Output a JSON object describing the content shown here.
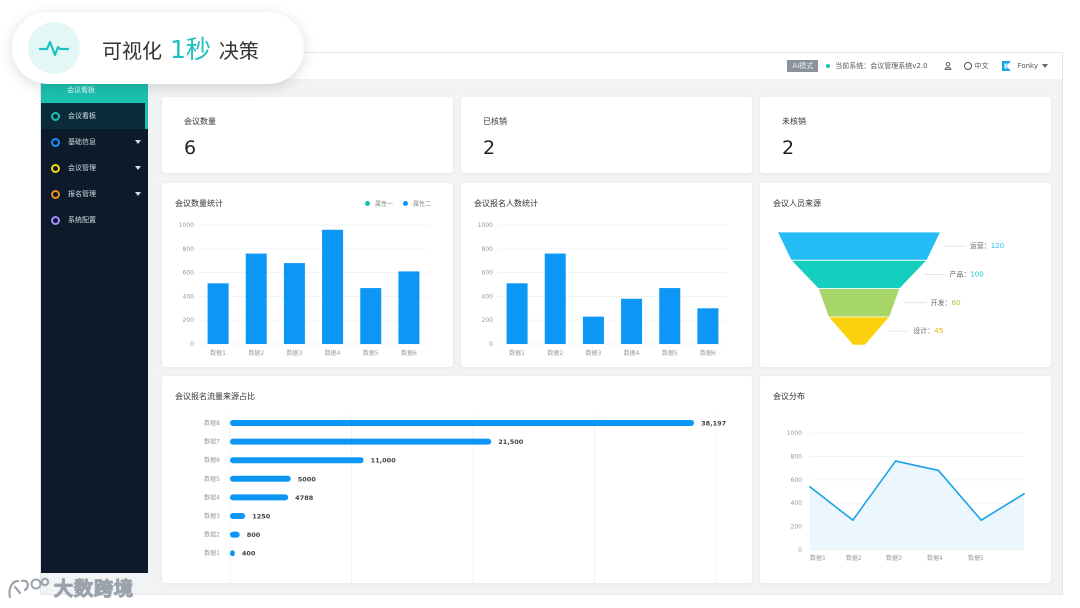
{
  "badge": {
    "before": "可视化",
    "emphasis": "1秒",
    "after": "决策"
  },
  "watermark": "大数跨境",
  "sidebar": {
    "header": "会议看板",
    "items": [
      {
        "label": "会议看板",
        "ring_color": "#1cc0b0",
        "active": true,
        "has_caret": false
      },
      {
        "label": "基础信息",
        "ring_color": "#1890ff",
        "active": false,
        "has_caret": true
      },
      {
        "label": "会议管理",
        "ring_color": "#f5d90a",
        "active": false,
        "has_caret": true
      },
      {
        "label": "报名管理",
        "ring_color": "#f08a24",
        "active": false,
        "has_caret": true
      },
      {
        "label": "系统配置",
        "ring_color": "#a78bfa",
        "active": false,
        "has_caret": false
      }
    ]
  },
  "topbar": {
    "mode": "AI模式",
    "system": "当前系统：会议管理系统v2.0",
    "language": "中文",
    "user": "Fonky"
  },
  "stats": [
    {
      "label": "会议数量",
      "value": "6"
    },
    {
      "label": "已核销",
      "value": "2"
    },
    {
      "label": "未核销",
      "value": "2"
    }
  ],
  "colors": {
    "accent": "#1cc0b0",
    "bar": "#0c97f6",
    "line": "#1aa3e8",
    "funnel": [
      "#25bdf5",
      "#14cfc0",
      "#a6d56a",
      "#fcd20f"
    ]
  },
  "chart_data": [
    {
      "type": "bar",
      "title": "会议数量统计",
      "legend": [
        "属性一",
        "属性二"
      ],
      "legend_colors": [
        "#1cc0b0",
        "#0c97f6"
      ],
      "categories": [
        "数据1",
        "数据2",
        "数据3",
        "数据4",
        "数据5",
        "数据6"
      ],
      "values": [
        510,
        760,
        680,
        960,
        470,
        610
      ],
      "ylim": [
        0,
        1000
      ],
      "yticks": [
        "0",
        "200",
        "400",
        "600",
        "800",
        "1000"
      ]
    },
    {
      "type": "bar",
      "title": "会议报名人数统计",
      "categories": [
        "数据1",
        "数据2",
        "数据3",
        "数据4",
        "数据5",
        "数据6"
      ],
      "values": [
        510,
        760,
        230,
        380,
        470,
        300
      ],
      "ylim": [
        0,
        1000
      ],
      "yticks": [
        "0",
        "200",
        "400",
        "600",
        "800",
        "1000"
      ]
    },
    {
      "type": "funnel",
      "title": "会议人员来源",
      "labels": [
        "运营：",
        "产品：",
        "开发：",
        "设计："
      ],
      "values": [
        120,
        100,
        60,
        45
      ]
    },
    {
      "type": "bar",
      "orientation": "horizontal",
      "title": "会议报名流量来源占比",
      "categories": [
        "数据8",
        "数据7",
        "数据6",
        "数据5",
        "数据4",
        "数据3",
        "数据2",
        "数据1"
      ],
      "values": [
        38197,
        21500,
        11000,
        5000,
        4788,
        1250,
        800,
        400
      ],
      "value_labels": [
        "38,197",
        "21,500",
        "11,000",
        "5000",
        "4788",
        "1250",
        "800",
        "400"
      ],
      "xlim": [
        0,
        40000
      ],
      "xticks": [
        "0",
        "10000",
        "20000",
        "30,000",
        "40,000"
      ]
    },
    {
      "type": "line",
      "title": "会议分布",
      "categories": [
        "数据1",
        "数据2",
        "数据3",
        "数据4",
        "数据5"
      ],
      "values": [
        540,
        255,
        760,
        680,
        255,
        480
      ],
      "ylim": [
        0,
        1000
      ],
      "yticks": [
        "0",
        "200",
        "400",
        "600",
        "800",
        "1000"
      ]
    }
  ]
}
